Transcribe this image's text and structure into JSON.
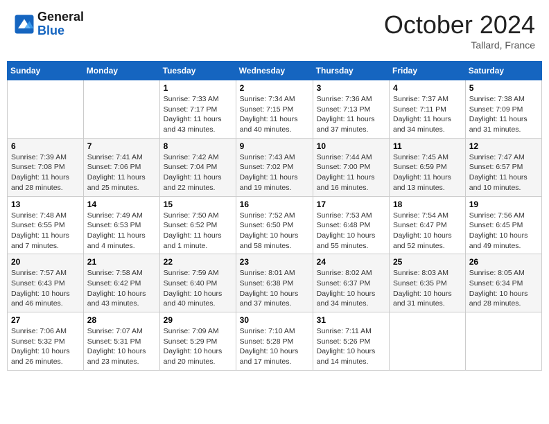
{
  "header": {
    "logo_line1": "General",
    "logo_line2": "Blue",
    "month_title": "October 2024",
    "location": "Tallard, France"
  },
  "weekdays": [
    "Sunday",
    "Monday",
    "Tuesday",
    "Wednesday",
    "Thursday",
    "Friday",
    "Saturday"
  ],
  "weeks": [
    [
      {
        "day": "",
        "info": ""
      },
      {
        "day": "",
        "info": ""
      },
      {
        "day": "1",
        "info": "Sunrise: 7:33 AM\nSunset: 7:17 PM\nDaylight: 11 hours and 43 minutes."
      },
      {
        "day": "2",
        "info": "Sunrise: 7:34 AM\nSunset: 7:15 PM\nDaylight: 11 hours and 40 minutes."
      },
      {
        "day": "3",
        "info": "Sunrise: 7:36 AM\nSunset: 7:13 PM\nDaylight: 11 hours and 37 minutes."
      },
      {
        "day": "4",
        "info": "Sunrise: 7:37 AM\nSunset: 7:11 PM\nDaylight: 11 hours and 34 minutes."
      },
      {
        "day": "5",
        "info": "Sunrise: 7:38 AM\nSunset: 7:09 PM\nDaylight: 11 hours and 31 minutes."
      }
    ],
    [
      {
        "day": "6",
        "info": "Sunrise: 7:39 AM\nSunset: 7:08 PM\nDaylight: 11 hours and 28 minutes."
      },
      {
        "day": "7",
        "info": "Sunrise: 7:41 AM\nSunset: 7:06 PM\nDaylight: 11 hours and 25 minutes."
      },
      {
        "day": "8",
        "info": "Sunrise: 7:42 AM\nSunset: 7:04 PM\nDaylight: 11 hours and 22 minutes."
      },
      {
        "day": "9",
        "info": "Sunrise: 7:43 AM\nSunset: 7:02 PM\nDaylight: 11 hours and 19 minutes."
      },
      {
        "day": "10",
        "info": "Sunrise: 7:44 AM\nSunset: 7:00 PM\nDaylight: 11 hours and 16 minutes."
      },
      {
        "day": "11",
        "info": "Sunrise: 7:45 AM\nSunset: 6:59 PM\nDaylight: 11 hours and 13 minutes."
      },
      {
        "day": "12",
        "info": "Sunrise: 7:47 AM\nSunset: 6:57 PM\nDaylight: 11 hours and 10 minutes."
      }
    ],
    [
      {
        "day": "13",
        "info": "Sunrise: 7:48 AM\nSunset: 6:55 PM\nDaylight: 11 hours and 7 minutes."
      },
      {
        "day": "14",
        "info": "Sunrise: 7:49 AM\nSunset: 6:53 PM\nDaylight: 11 hours and 4 minutes."
      },
      {
        "day": "15",
        "info": "Sunrise: 7:50 AM\nSunset: 6:52 PM\nDaylight: 11 hours and 1 minute."
      },
      {
        "day": "16",
        "info": "Sunrise: 7:52 AM\nSunset: 6:50 PM\nDaylight: 10 hours and 58 minutes."
      },
      {
        "day": "17",
        "info": "Sunrise: 7:53 AM\nSunset: 6:48 PM\nDaylight: 10 hours and 55 minutes."
      },
      {
        "day": "18",
        "info": "Sunrise: 7:54 AM\nSunset: 6:47 PM\nDaylight: 10 hours and 52 minutes."
      },
      {
        "day": "19",
        "info": "Sunrise: 7:56 AM\nSunset: 6:45 PM\nDaylight: 10 hours and 49 minutes."
      }
    ],
    [
      {
        "day": "20",
        "info": "Sunrise: 7:57 AM\nSunset: 6:43 PM\nDaylight: 10 hours and 46 minutes."
      },
      {
        "day": "21",
        "info": "Sunrise: 7:58 AM\nSunset: 6:42 PM\nDaylight: 10 hours and 43 minutes."
      },
      {
        "day": "22",
        "info": "Sunrise: 7:59 AM\nSunset: 6:40 PM\nDaylight: 10 hours and 40 minutes."
      },
      {
        "day": "23",
        "info": "Sunrise: 8:01 AM\nSunset: 6:38 PM\nDaylight: 10 hours and 37 minutes."
      },
      {
        "day": "24",
        "info": "Sunrise: 8:02 AM\nSunset: 6:37 PM\nDaylight: 10 hours and 34 minutes."
      },
      {
        "day": "25",
        "info": "Sunrise: 8:03 AM\nSunset: 6:35 PM\nDaylight: 10 hours and 31 minutes."
      },
      {
        "day": "26",
        "info": "Sunrise: 8:05 AM\nSunset: 6:34 PM\nDaylight: 10 hours and 28 minutes."
      }
    ],
    [
      {
        "day": "27",
        "info": "Sunrise: 7:06 AM\nSunset: 5:32 PM\nDaylight: 10 hours and 26 minutes."
      },
      {
        "day": "28",
        "info": "Sunrise: 7:07 AM\nSunset: 5:31 PM\nDaylight: 10 hours and 23 minutes."
      },
      {
        "day": "29",
        "info": "Sunrise: 7:09 AM\nSunset: 5:29 PM\nDaylight: 10 hours and 20 minutes."
      },
      {
        "day": "30",
        "info": "Sunrise: 7:10 AM\nSunset: 5:28 PM\nDaylight: 10 hours and 17 minutes."
      },
      {
        "day": "31",
        "info": "Sunrise: 7:11 AM\nSunset: 5:26 PM\nDaylight: 10 hours and 14 minutes."
      },
      {
        "day": "",
        "info": ""
      },
      {
        "day": "",
        "info": ""
      }
    ]
  ]
}
